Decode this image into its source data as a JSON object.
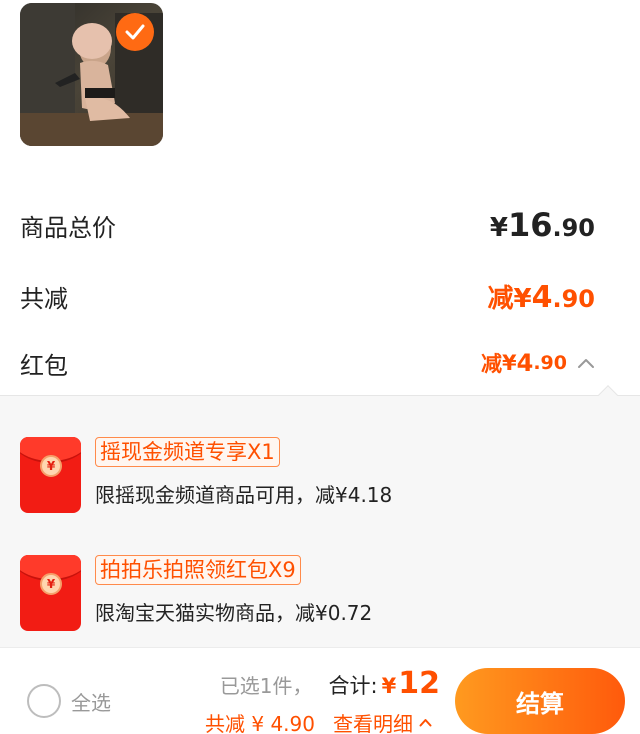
{
  "product": {
    "image_icon": "figure-photo",
    "selected_icon": "check-icon"
  },
  "summary": {
    "total_label": "商品总价",
    "total_yen": "¥",
    "total_int": "16",
    "total_dec": ".90",
    "discount_label": "共减",
    "discount_prefix": "减",
    "discount_yen": "¥",
    "discount_int": "4",
    "discount_dec": ".90",
    "redpacket_label": "红包",
    "redpacket_prefix": "减",
    "redpacket_yen": "¥",
    "redpacket_int": "4",
    "redpacket_dec": ".90"
  },
  "coupons": [
    {
      "icon": "red-packet-icon",
      "coin_symbol": "¥",
      "tag": "摇现金频道专享X1",
      "desc": "限摇现金频道商品可用，减¥4.18"
    },
    {
      "icon": "red-packet-icon",
      "coin_symbol": "¥",
      "tag": "拍拍乐拍照领红包X9",
      "desc": "限淘宝天猫实物商品，减¥0.72"
    }
  ],
  "bottom_bar": {
    "select_all_label": "全选",
    "selected_count": "已选1件，",
    "total_label": "合计:",
    "total_yen": "¥",
    "total_value": "12",
    "discount_summary": "共减 ¥ 4.90",
    "detail_link": "查看明细",
    "checkout_label": "结算"
  },
  "colors": {
    "accent": "#ff5000",
    "checkout_gradient_start": "#ff9a1f",
    "checkout_gradient_end": "#ff5a0c",
    "panel_bg": "#f7f7f7"
  }
}
